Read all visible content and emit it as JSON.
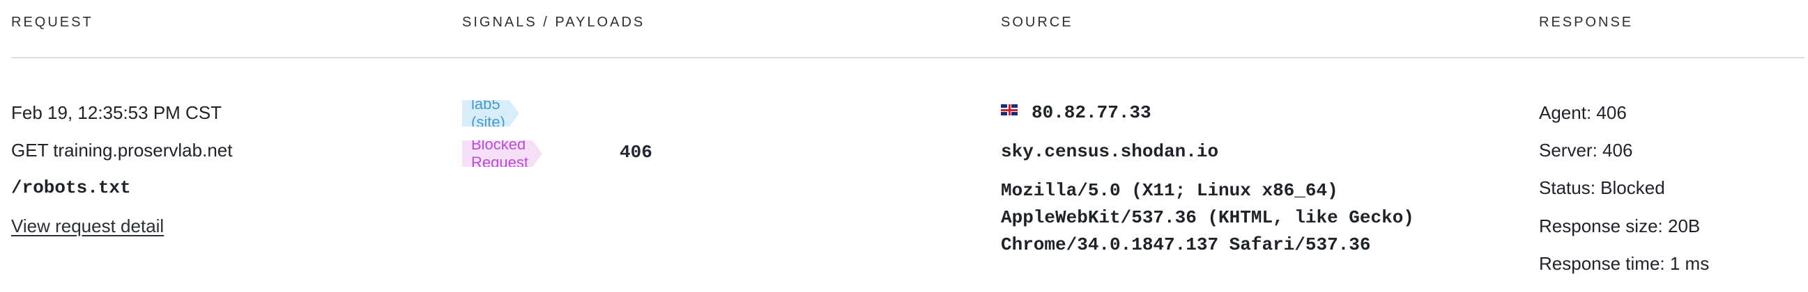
{
  "headers": {
    "request": "REQUEST",
    "signals": "SIGNALS / PAYLOADS",
    "source": "SOURCE",
    "response": "RESPONSE"
  },
  "row": {
    "request": {
      "timestamp": "Feb 19, 12:35:53 PM CST",
      "method_host": "GET training.proservlab.net",
      "path": "/robots.txt",
      "detail_link": "View request detail"
    },
    "signals": {
      "site_tag": "lab5 (site)",
      "blocked_tag": "Blocked Request",
      "blocked_code": "406"
    },
    "source": {
      "flag_icon": "uk-flag-icon",
      "ip": "80.82.77.33",
      "hostname": "sky.census.shodan.io",
      "user_agent_lines": [
        "Mozilla/5.0 (X11; Linux x86_64)",
        "AppleWebKit/537.36 (KHTML, like Gecko)",
        "Chrome/34.0.1847.137 Safari/537.36"
      ]
    },
    "response": {
      "agent": "Agent: 406",
      "server": "Server: 406",
      "status": "Status: Blocked",
      "size": "Response size: 20B",
      "time": "Response time: 1 ms"
    }
  },
  "colors": {
    "site_tag_bg": "#d7eefa",
    "site_tag_text": "#4a9ac9",
    "blocked_tag_bg": "#f5e0f7",
    "blocked_tag_text": "#b94fd0"
  }
}
